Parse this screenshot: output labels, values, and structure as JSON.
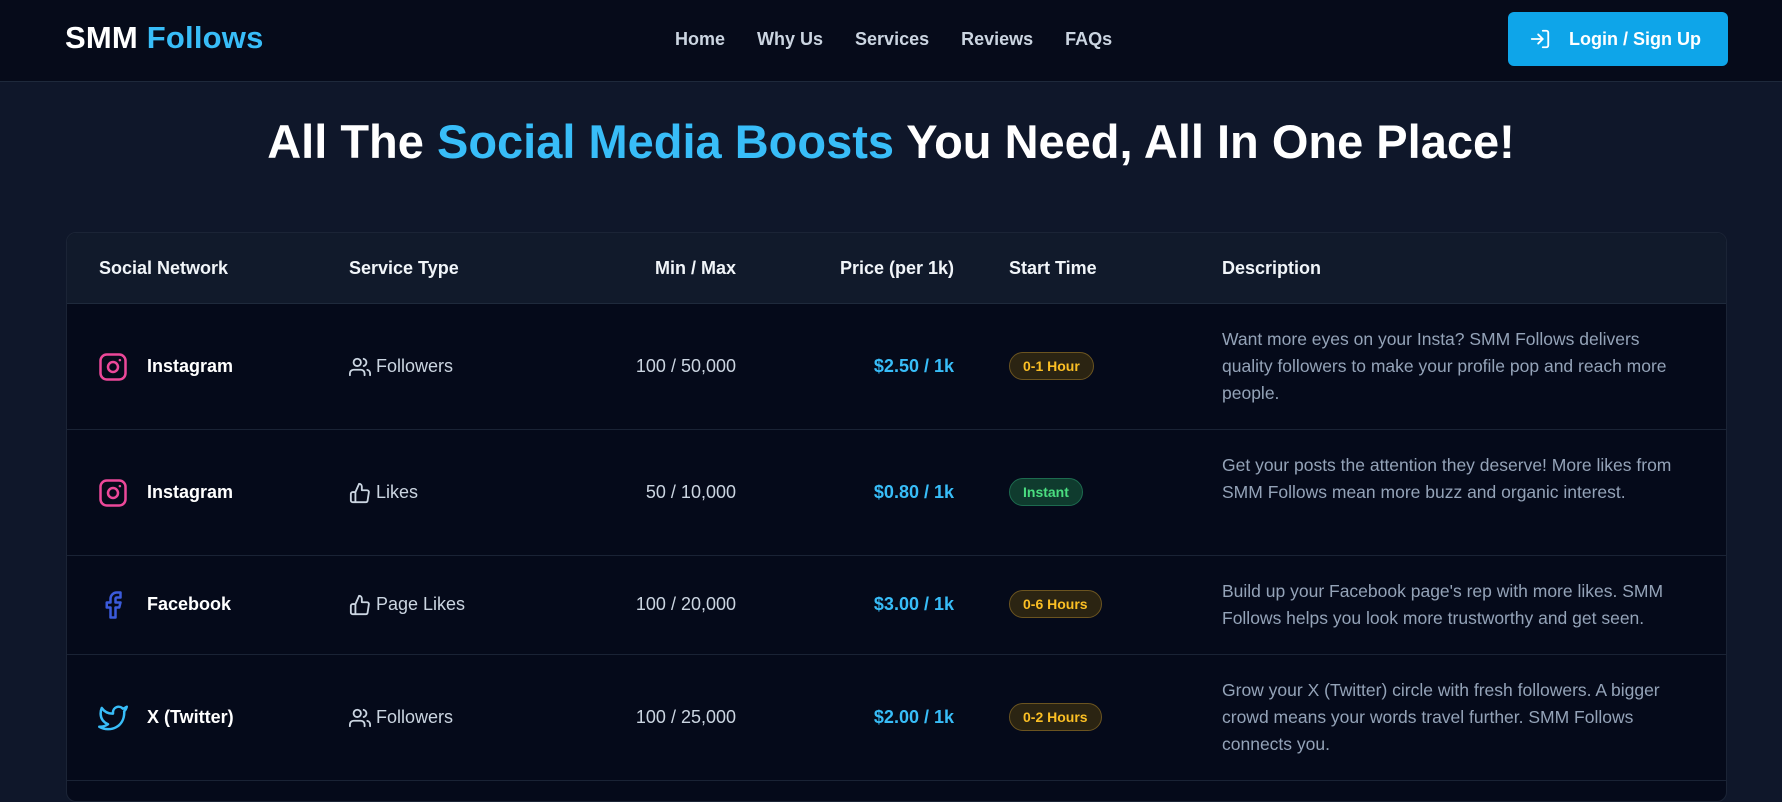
{
  "navbar": {
    "brand_part1": "SMM",
    "brand_part2": "Follows",
    "links": [
      "Home",
      "Why Us",
      "Services",
      "Reviews",
      "FAQs"
    ],
    "login_label": "Login / Sign Up"
  },
  "hero": {
    "title_before": "All The ",
    "title_accent": "Social Media Boosts",
    "title_after": " You Need, All In One Place!"
  },
  "table": {
    "headers": {
      "network": "Social Network",
      "service": "Service Type",
      "minmax": "Min / Max",
      "price": "Price (per 1k)",
      "start": "Start Time",
      "description": "Description"
    },
    "rows": [
      {
        "network": "Instagram",
        "network_icon": "instagram-icon",
        "service": "Followers",
        "service_icon": "users-icon",
        "minmax": "100 / 50,000",
        "price": "$2.50 / 1k",
        "start": "0-1 Hour",
        "start_color": "amber",
        "description": "Want more eyes on your Insta? SMM Follows delivers quality followers to make your profile pop and reach more people."
      },
      {
        "network": "Instagram",
        "network_icon": "instagram-icon",
        "service": "Likes",
        "service_icon": "thumbs-up-icon",
        "minmax": "50 / 10,000",
        "price": "$0.80 / 1k",
        "start": "Instant",
        "start_color": "green",
        "description": "Get your posts the attention they deserve! More likes from SMM Follows mean more buzz and organic interest."
      },
      {
        "network": "Facebook",
        "network_icon": "facebook-icon",
        "service": "Page Likes",
        "service_icon": "thumbs-up-icon",
        "minmax": "100 / 20,000",
        "price": "$3.00 / 1k",
        "start": "0-6 Hours",
        "start_color": "amber",
        "description": "Build up your Facebook page's rep with more likes. SMM Follows helps you look more trustworthy and get seen."
      },
      {
        "network": "X (Twitter)",
        "network_icon": "twitter-icon",
        "service": "Followers",
        "service_icon": "users-icon",
        "minmax": "100 / 25,000",
        "price": "$2.00 / 1k",
        "start": "0-2 Hours",
        "start_color": "amber",
        "description": "Grow your X (Twitter) circle with fresh followers. A bigger crowd means your words travel further. SMM Follows connects you."
      }
    ]
  },
  "colors": {
    "accent": "#38bdf8",
    "button": "#0ea5e9",
    "background": "#0f172a",
    "instagram": "#ec4899",
    "facebook": "#3b5bdb",
    "twitter": "#38bdf8",
    "badge_amber": "#fbbf24",
    "badge_green": "#4ade80"
  }
}
